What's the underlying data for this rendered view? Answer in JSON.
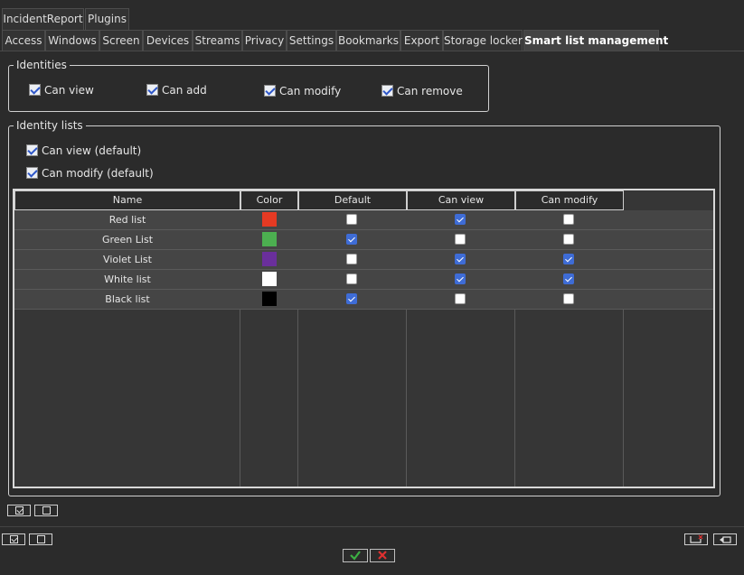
{
  "tabs_top": [
    {
      "label": "IncidentReport"
    },
    {
      "label": "Plugins"
    }
  ],
  "tabs_main": [
    {
      "label": "Access"
    },
    {
      "label": "Windows"
    },
    {
      "label": "Screen"
    },
    {
      "label": "Devices"
    },
    {
      "label": "Streams"
    },
    {
      "label": "Privacy"
    },
    {
      "label": "Settings"
    },
    {
      "label": "Bookmarks"
    },
    {
      "label": "Export"
    },
    {
      "label": "Storage locker"
    },
    {
      "label": "Smart list management",
      "active": true
    }
  ],
  "identities": {
    "title": "Identities",
    "options": [
      {
        "label": "Can view",
        "checked": true
      },
      {
        "label": "Can add",
        "checked": true
      },
      {
        "label": "Can modify",
        "checked": true
      },
      {
        "label": "Can remove",
        "checked": true
      }
    ]
  },
  "identity_lists": {
    "title": "Identity lists",
    "options": [
      {
        "label": "Can view (default)",
        "checked": true
      },
      {
        "label": "Can modify (default)",
        "checked": true
      }
    ],
    "columns": [
      "Name",
      "Color",
      "Default",
      "Can view",
      "Can modify"
    ],
    "rows": [
      {
        "name": "Red list",
        "color": "#e53a23",
        "default": false,
        "can_view": true,
        "can_modify": false
      },
      {
        "name": "Green List",
        "color": "#4caf50",
        "default": true,
        "can_view": false,
        "can_modify": false
      },
      {
        "name": "Violet List",
        "color": "#6a2f9c",
        "default": false,
        "can_view": true,
        "can_modify": true
      },
      {
        "name": "White list",
        "color": "#ffffff",
        "default": false,
        "can_view": true,
        "can_modify": true
      },
      {
        "name": "Black list",
        "color": "#000000",
        "default": true,
        "can_view": false,
        "can_modify": false
      }
    ]
  },
  "footer": {
    "ok_icon": "checkmark-icon",
    "cancel_icon": "cross-icon",
    "ok_color": "#3cb043",
    "cancel_color": "#e03030"
  }
}
